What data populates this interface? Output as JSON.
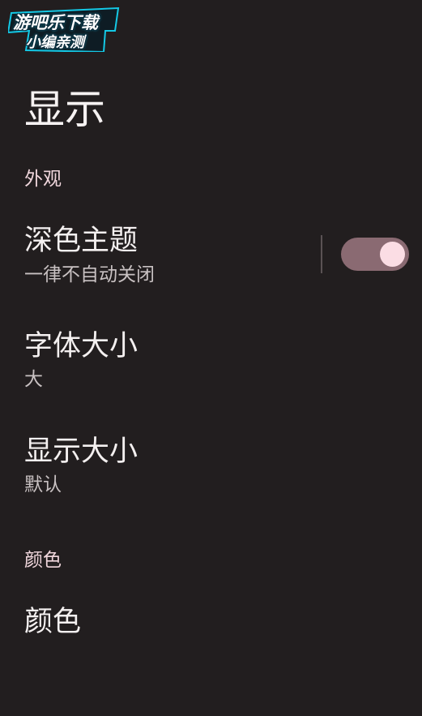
{
  "watermark": {
    "line1": "游吧乐下载",
    "line2": "小编亲测"
  },
  "page": {
    "title": "显示"
  },
  "sections": {
    "appearance": {
      "header": "外观",
      "dark_theme": {
        "title": "深色主题",
        "summary": "一律不自动关闭",
        "enabled": true
      },
      "font_size": {
        "title": "字体大小",
        "summary": "大"
      },
      "display_size": {
        "title": "显示大小",
        "summary": "默认"
      }
    },
    "color": {
      "header": "颜色",
      "color_item": {
        "title": "颜色"
      }
    }
  },
  "colors": {
    "background": "#221e1f",
    "accent_track": "#8a6a72",
    "accent_thumb": "#fbdde4",
    "section_header": "#f0d6dc",
    "watermark_glow": "#14c9e6"
  }
}
